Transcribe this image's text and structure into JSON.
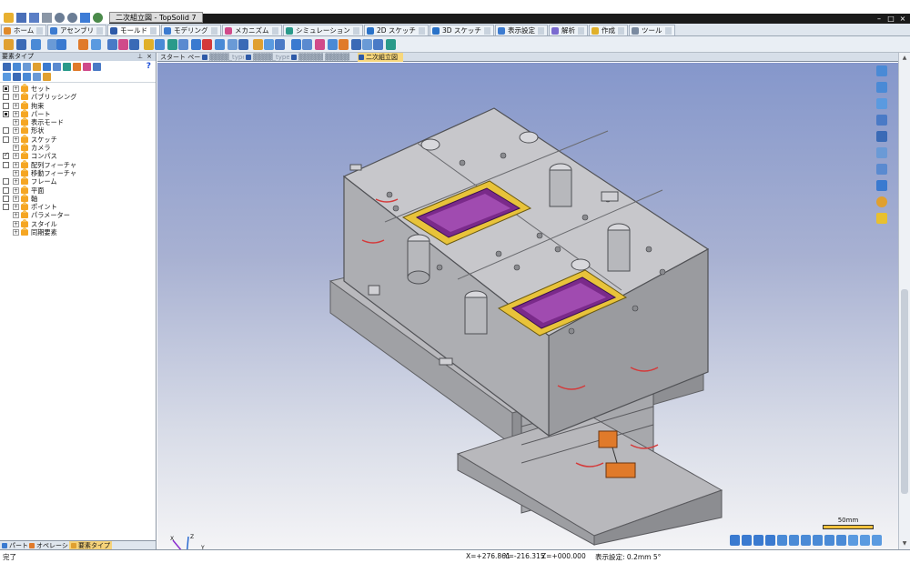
{
  "window": {
    "title": "二次組立図 - TopSolid 7"
  },
  "ribbon_tabs": [
    {
      "label": "ホーム",
      "color": "#e08a2a"
    },
    {
      "label": "アセンブリ",
      "color": "#3c7bd0"
    },
    {
      "label": "モールド",
      "color": "#2e5aa8"
    },
    {
      "label": "モデリング",
      "color": "#3c7bd0"
    },
    {
      "label": "メカニズム",
      "color": "#d04a8a"
    },
    {
      "label": "シミュレーション",
      "color": "#2a9a8a"
    },
    {
      "label": "2D スケッチ",
      "color": "#2a72c8"
    },
    {
      "label": "3D スケッチ",
      "color": "#2a72c8"
    },
    {
      "label": "表示設定",
      "color": "#3c7bd0"
    },
    {
      "label": "解析",
      "color": "#7a6ad0"
    },
    {
      "label": "作成",
      "color": "#e0b02a"
    },
    {
      "label": "ツール",
      "color": "#7a8aa0"
    }
  ],
  "left_panel": {
    "title": "要素タイプ",
    "help": "?",
    "tree": [
      {
        "label": "セット",
        "check": "on"
      },
      {
        "label": "パブリッシング",
        "check": "off"
      },
      {
        "label": "拘束",
        "check": "off"
      },
      {
        "label": "パート",
        "check": "on"
      },
      {
        "label": "表示モード",
        "check": "none"
      },
      {
        "label": "形状",
        "check": "off"
      },
      {
        "label": "スケッチ",
        "check": "off"
      },
      {
        "label": "カメラ",
        "check": "none"
      },
      {
        "label": "コンパス",
        "check": "tick"
      },
      {
        "label": "配列フィーチャ",
        "check": "off"
      },
      {
        "label": "移動フィーチャ",
        "check": "none"
      },
      {
        "label": "フレーム",
        "check": "off"
      },
      {
        "label": "平面",
        "check": "off"
      },
      {
        "label": "軸",
        "check": "off"
      },
      {
        "label": "ポイント",
        "check": "off"
      },
      {
        "label": "パラメーター",
        "check": "none"
      },
      {
        "label": "スタイル",
        "check": "none"
      },
      {
        "label": "同期要素",
        "check": "none"
      }
    ],
    "bottom_tabs": [
      {
        "label": "パート",
        "active": false
      },
      {
        "label": "オペレーション",
        "active": false
      },
      {
        "label": "要素タイプ",
        "active": true
      }
    ]
  },
  "doc_tabs": [
    {
      "label": "スタート ページ",
      "state": "normal"
    },
    {
      "label": "▓▓▓▓_type_A",
      "state": "blur"
    },
    {
      "label": "▓▓▓▓_type_A",
      "state": "blur"
    },
    {
      "label": "▓▓▓▓▓ ▓▓▓▓▓",
      "state": "blur"
    },
    {
      "label": "二次組立図",
      "state": "active"
    }
  ],
  "viewport": {
    "scale_label": "50mm",
    "axis_labels": {
      "x": "X",
      "y": "Y",
      "z": "Z"
    }
  },
  "status": {
    "message": "完了",
    "x": "X=+276.861",
    "y": "Y=-216.315",
    "z": "Z=+000.000",
    "display": "表示設定: 0.2mm 5°"
  }
}
